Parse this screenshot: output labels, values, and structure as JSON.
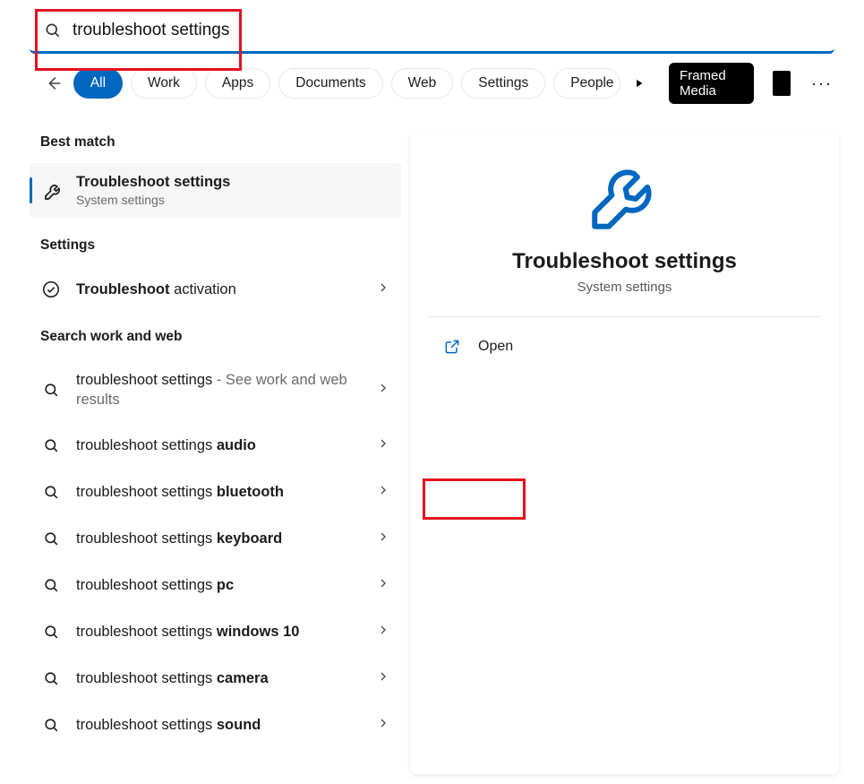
{
  "search": {
    "value": "troubleshoot settings"
  },
  "tabs": {
    "all": "All",
    "work": "Work",
    "apps": "Apps",
    "documents": "Documents",
    "web": "Web",
    "settings": "Settings",
    "people": "People",
    "framed_media": "Framed Media"
  },
  "left": {
    "best_match": "Best match",
    "best_item": {
      "title": "Troubleshoot settings",
      "subtitle": "System settings"
    },
    "settings_header": "Settings",
    "settings_item": {
      "bold": "Troubleshoot",
      "rest": " activation"
    },
    "search_header": "Search work and web",
    "results": [
      {
        "prefix": "troubleshoot settings",
        "suffix": "",
        "dim": " - See work and web results"
      },
      {
        "prefix": "troubleshoot settings ",
        "suffix": "audio",
        "dim": ""
      },
      {
        "prefix": "troubleshoot settings ",
        "suffix": "bluetooth",
        "dim": ""
      },
      {
        "prefix": "troubleshoot settings ",
        "suffix": "keyboard",
        "dim": ""
      },
      {
        "prefix": "troubleshoot settings ",
        "suffix": "pc",
        "dim": ""
      },
      {
        "prefix": "troubleshoot settings ",
        "suffix": "windows 10",
        "dim": ""
      },
      {
        "prefix": "troubleshoot settings ",
        "suffix": "camera",
        "dim": ""
      },
      {
        "prefix": "troubleshoot settings ",
        "suffix": "sound",
        "dim": ""
      }
    ]
  },
  "right": {
    "title": "Troubleshoot settings",
    "subtitle": "System settings",
    "open": "Open"
  }
}
